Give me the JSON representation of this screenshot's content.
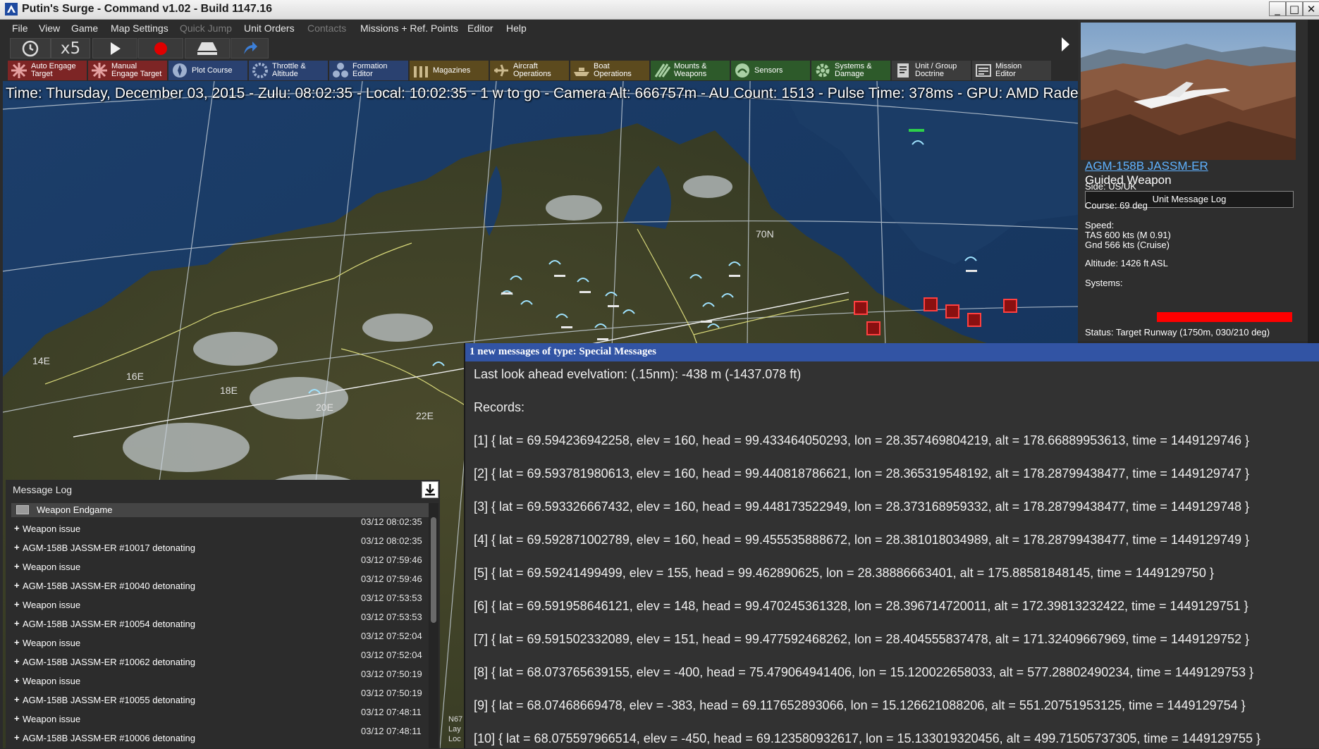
{
  "window": {
    "title": "Putin's Surge - Command v1.02 - Build 1147.16",
    "controls": [
      "_",
      "□",
      "✕"
    ]
  },
  "menu": [
    {
      "label": "File",
      "enabled": true
    },
    {
      "label": "View",
      "enabled": true
    },
    {
      "label": "Game",
      "enabled": true
    },
    {
      "label": "Map Settings",
      "enabled": true
    },
    {
      "label": "Quick Jump",
      "enabled": false
    },
    {
      "label": "Unit Orders",
      "enabled": true
    },
    {
      "label": "Contacts",
      "enabled": false
    },
    {
      "label": "Missions + Ref. Points",
      "enabled": true
    },
    {
      "label": "Editor",
      "enabled": true
    },
    {
      "label": "Help",
      "enabled": true
    }
  ],
  "time_controls": {
    "speed": "x5",
    "buttons": [
      "clock-icon",
      "play-icon",
      "record-icon",
      "eject-icon",
      "jump-arrow-icon"
    ]
  },
  "toolbar": [
    {
      "label": "Auto Engage\nTarget",
      "icon": "crosshair-icon",
      "color": "#7d2525"
    },
    {
      "label": "Manual\nEngage Target",
      "icon": "crosshair-icon",
      "color": "#7d2525"
    },
    {
      "label": "Plot Course",
      "icon": "compass-icon",
      "color": "#2a4170"
    },
    {
      "label": "Throttle &\nAltitude",
      "icon": "throttle-icon",
      "color": "#2a4170"
    },
    {
      "label": "Formation\nEditor",
      "icon": "formation-icon",
      "color": "#2a4170"
    },
    {
      "label": "Magazines",
      "icon": "magazine-icon",
      "color": "#5c4a1e"
    },
    {
      "label": "Aircraft\nOperations",
      "icon": "aircraft-icon",
      "color": "#5c4a1e"
    },
    {
      "label": "Boat\nOperations",
      "icon": "boat-icon",
      "color": "#5c4a1e"
    },
    {
      "label": "Mounts &\nWeapons",
      "icon": "weapons-icon",
      "color": "#2d5a2a"
    },
    {
      "label": "Sensors",
      "icon": "sensor-icon",
      "color": "#2d5a2a"
    },
    {
      "label": "Systems &\nDamage",
      "icon": "gear-icon",
      "color": "#2d5a2a"
    },
    {
      "label": "Unit / Group\nDoctrine",
      "icon": "doctrine-icon",
      "color": "#3c3c3c"
    },
    {
      "label": "Mission\nEditor",
      "icon": "mission-icon",
      "color": "#3c3c3c"
    }
  ],
  "status_line": "Time: Thursday, December 03, 2015 - Zulu: 08:02:35 - Local: 10:02:35 - 1 w to go -  Camera Alt: 666757m  - AU Count: 1513 - Pulse Time: 378ms - GPU: AMD Radeon",
  "map": {
    "grid_labels": [
      "70N",
      "14E",
      "16E",
      "18E",
      "20E",
      "22E"
    ],
    "corner_text": [
      "N67",
      "Lay",
      "Loc"
    ]
  },
  "unit_panel": {
    "name": "AGM-158B JASSM-ER",
    "type": "Guided Weapon",
    "log_button": "Unit Message Log",
    "side": "Side: US/UK",
    "course": "Course: 69 deg",
    "speed_label": "Speed:",
    "speed_tas": "TAS 600 kts (M 0.91)",
    "speed_gnd": "Gnd 566 kts (Cruise)",
    "altitude": "Altitude: 1426 ft ASL",
    "systems_label": "Systems:",
    "systems_color": "#ff0000",
    "status": "Status: Target Runway (1750m, 030/210 deg)"
  },
  "message_log": {
    "title": "Message Log",
    "group": "Weapon Endgame",
    "entries": [
      {
        "text": "Weapon issue",
        "time": "03/12 08:02:35"
      },
      {
        "text": "AGM-158B JASSM-ER #10017 detonating",
        "time": "03/12 08:02:35"
      },
      {
        "text": "Weapon issue",
        "time": "03/12 07:59:46"
      },
      {
        "text": "AGM-158B JASSM-ER #10040 detonating",
        "time": "03/12 07:59:46"
      },
      {
        "text": "Weapon issue",
        "time": "03/12 07:53:53"
      },
      {
        "text": "AGM-158B JASSM-ER #10054 detonating",
        "time": "03/12 07:53:53"
      },
      {
        "text": "Weapon issue",
        "time": "03/12 07:52:04"
      },
      {
        "text": "AGM-158B JASSM-ER #10062 detonating",
        "time": "03/12 07:52:04"
      },
      {
        "text": "Weapon issue",
        "time": "03/12 07:50:19"
      },
      {
        "text": "AGM-158B JASSM-ER #10055 detonating",
        "time": "03/12 07:50:19"
      },
      {
        "text": "Weapon issue",
        "time": "03/12 07:48:11"
      },
      {
        "text": "AGM-158B JASSM-ER #10006 detonating",
        "time": "03/12 07:48:11"
      }
    ]
  },
  "popup": {
    "title": "1 new messages of type: Special Messages",
    "lines": [
      "Last look ahead evelvation: (.15nm): -438 m (-1437.078 ft)",
      "Records:",
      "[1] { lat = 69.594236942258, elev = 160, head = 99.433464050293, lon = 28.357469804219, alt = 178.66889953613, time = 1449129746 }",
      "[2] { lat = 69.593781980613, elev = 160, head = 99.440818786621, lon = 28.365319548192, alt = 178.28799438477, time = 1449129747 }",
      "[3] { lat = 69.593326667432, elev = 160, head = 99.448173522949, lon = 28.373168959332, alt = 178.28799438477, time = 1449129748 }",
      "[4] { lat = 69.592871002789, elev = 160, head = 99.455535888672, lon = 28.381018034989, alt = 178.28799438477, time = 1449129749 }",
      "[5] { lat = 69.59241499499, elev = 155, head = 99.462890625, lon = 28.38886663401, alt = 175.88581848145, time = 1449129750 }",
      "[6] { lat = 69.591958646121, elev = 148, head = 99.470245361328, lon = 28.396714720011, alt = 172.39813232422, time = 1449129751 }",
      "[7] { lat = 69.591502332089, elev = 151, head = 99.477592468262, lon = 28.404555837478, alt = 171.32409667969, time = 1449129752 }",
      "[8] { lat = 68.073765639155, elev = -400, head = 75.479064941406, lon = 15.120022658033, alt = 577.28802490234, time = 1449129753 }",
      "[9] { lat = 68.07468669478, elev = -383, head = 69.117652893066, lon = 15.126621088206, alt = 551.20751953125, time = 1449129754 }",
      "[10] { lat = 68.075597966514, elev = -450, head = 69.123580932617, lon = 15.133019320456, alt = 499.71505737305, time = 1449129755 }"
    ]
  }
}
